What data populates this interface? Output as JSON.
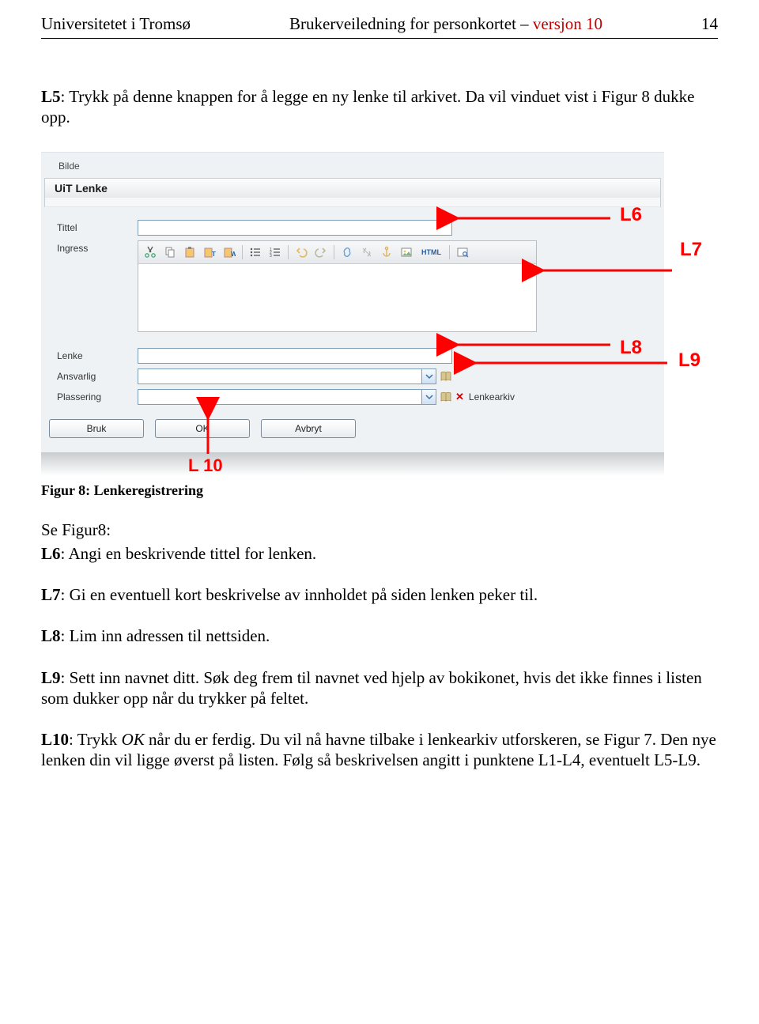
{
  "header": {
    "left": "Universitetet i Tromsø",
    "center_black": "Brukerveiledning for personkortet – ",
    "center_red": "versjon 10",
    "page_no": "14"
  },
  "intro": {
    "l5_label": "L5",
    "l5_text": ": Trykk på denne knappen for å legge en ny lenke til arkivet. Da vil vinduet vist i Figur 8 dukke opp."
  },
  "figure": {
    "caption": "Figur 8: Lenkeregistrering"
  },
  "appwin": {
    "bilde": "Bilde",
    "panel_title": "UiT Lenke",
    "labels": {
      "tittel": "Tittel",
      "ingress": "Ingress",
      "lenke": "Lenke",
      "ansvarlig": "Ansvarlig",
      "plassering": "Plassering"
    },
    "toolbar": {
      "html": "HTML"
    },
    "lenkearkiv": "Lenkearkiv",
    "buttons": {
      "bruk": "Bruk",
      "ok": "OK",
      "avbryt": "Avbryt"
    }
  },
  "annotations": {
    "l6": "L6",
    "l7": "L7",
    "l8": "L8",
    "l9": "L9",
    "l10": "L 10"
  },
  "post": {
    "sefigur": "Se Figur8:",
    "l6_label": "L6",
    "l6_text": ": Angi en beskrivende tittel for lenken.",
    "l7_label": "L7",
    "l7_text": ": Gi en eventuell kort beskrivelse av innholdet på siden lenken peker til.",
    "l8_label": "L8",
    "l8_text": ": Lim inn adressen til nettsiden.",
    "l9_label": "L9",
    "l9_text": ": Sett inn navnet ditt. Søk deg frem til navnet ved hjelp av bokikonet, hvis det ikke finnes i listen som dukker opp når du trykker på feltet.",
    "l10_label": "L10",
    "l10_text_a": ": Trykk ",
    "l10_ok": "OK",
    "l10_text_b": " når du er ferdig. Du vil nå havne tilbake i lenkearkiv utforskeren, se Figur 7. Den nye lenken din vil ligge øverst på listen. Følg så beskrivelsen angitt i punktene L1-L4, eventuelt L5-L9."
  }
}
